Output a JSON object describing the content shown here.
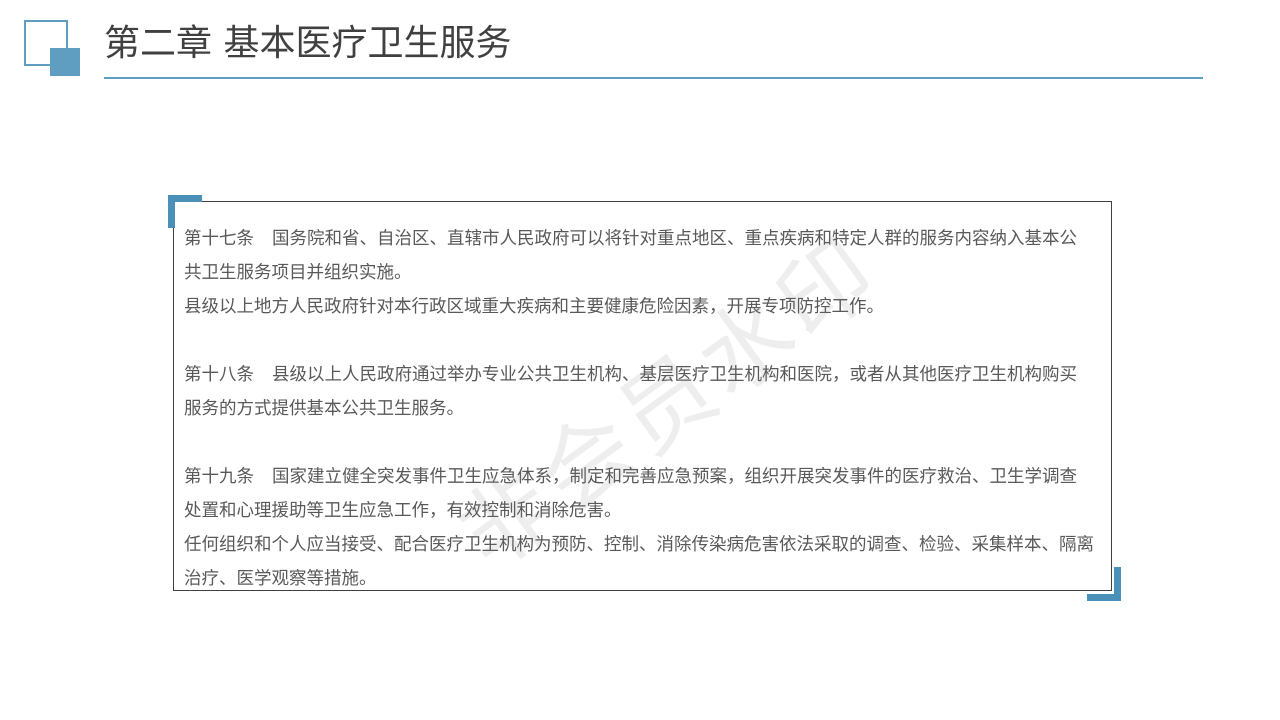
{
  "header": {
    "title": "第二章 基本医疗卫生服务"
  },
  "watermark": "非会员水印",
  "colors": {
    "accent": "#5f9dc1",
    "corner": "#4a90b8",
    "text": "#595959",
    "title": "#404040"
  },
  "articles": [
    {
      "number": "第十七条",
      "lines": [
        "国务院和省、自治区、直辖市人民政府可以将针对重点地区、重点疾病和特定人群的服务内容纳入基本公共卫生服务项目并组织实施。",
        "县级以上地方人民政府针对本行政区域重大疾病和主要健康危险因素，开展专项防控工作。"
      ]
    },
    {
      "number": "第十八条",
      "lines": [
        "县级以上人民政府通过举办专业公共卫生机构、基层医疗卫生机构和医院，或者从其他医疗卫生机构购买服务的方式提供基本公共卫生服务。"
      ]
    },
    {
      "number": "第十九条",
      "lines": [
        "国家建立健全突发事件卫生应急体系，制定和完善应急预案，组织开展突发事件的医疗救治、卫生学调查处置和心理援助等卫生应急工作，有效控制和消除危害。",
        "任何组织和个人应当接受、配合医疗卫生机构为预防、控制、消除传染病危害依法采取的调查、检验、采集样本、隔离治疗、医学观察等措施。"
      ]
    }
  ]
}
